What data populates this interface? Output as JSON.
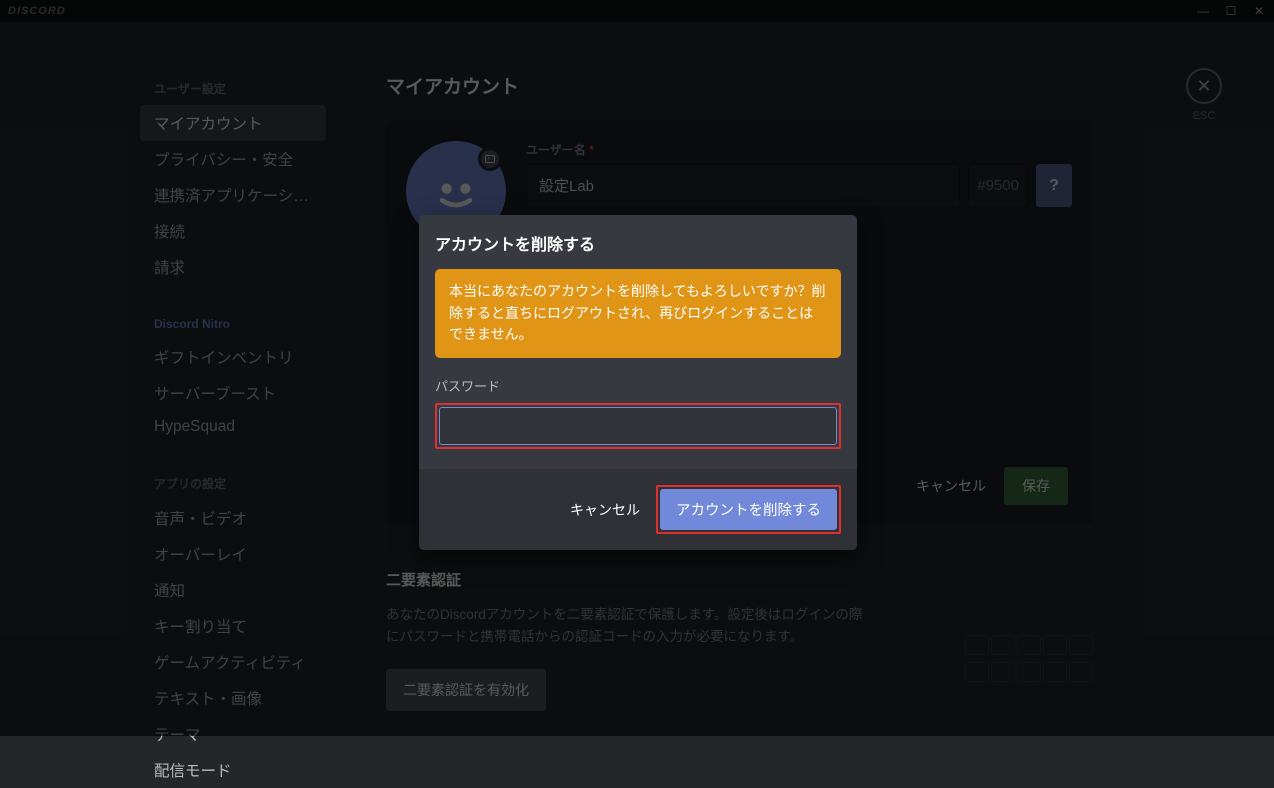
{
  "app_name": "DISCORD",
  "window_controls": {
    "min": "—",
    "max": "☐",
    "close": "✕"
  },
  "sidebar": {
    "user_settings_header": "ユーザー設定",
    "items_settings": [
      {
        "label": "マイアカウント",
        "active": true
      },
      {
        "label": "プライバシー・安全",
        "active": false
      },
      {
        "label": "連携済アプリケーショ...",
        "active": false
      },
      {
        "label": "接続",
        "active": false
      },
      {
        "label": "請求",
        "active": false
      }
    ],
    "nitro_header": "Discord Nitro",
    "items_nitro": [
      {
        "label": "ギフトインベントリ"
      },
      {
        "label": "サーバーブースト"
      },
      {
        "label": "HypeSquad"
      }
    ],
    "app_settings_header": "アプリの設定",
    "items_app": [
      {
        "label": "音声・ビデオ"
      },
      {
        "label": "オーバーレイ"
      },
      {
        "label": "通知"
      },
      {
        "label": "キー割り当て"
      },
      {
        "label": "ゲームアクティビティ"
      },
      {
        "label": "テキスト・画像"
      },
      {
        "label": "テーマ"
      },
      {
        "label": "配信モード"
      }
    ]
  },
  "page": {
    "title": "マイアカウント",
    "username_label": "ユーザー名",
    "username_value": "設定Lab",
    "discriminator": "#9500",
    "help": "?",
    "cancel": "キャンセル",
    "save": "保存",
    "twofa_title": "二要素認証",
    "twofa_desc": "あなたのDiscordアカウントを二要素認証で保護します。設定後はログインの際にパスワードと携帯電話からの認証コードの入力が必要になります。",
    "twofa_btn": "二要素認証を有効化",
    "esc": "ESC"
  },
  "modal": {
    "title": "アカウントを削除する",
    "warning": "本当にあなたのアカウントを削除してもよろしいですか？削除すると直ちにログアウトされ、再びログインすることはできません。",
    "password_label": "パスワード",
    "cancel": "キャンセル",
    "confirm": "アカウントを削除する",
    "value": ""
  }
}
